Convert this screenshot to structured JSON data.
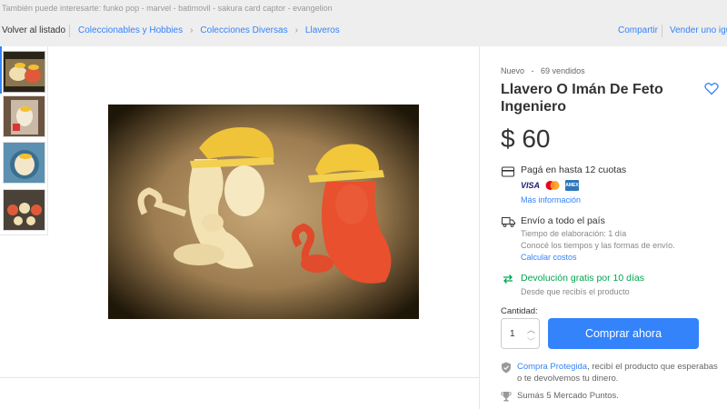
{
  "suggestions": "También puede interesarte: funko pop - marvel - batimovil - sakura card captor - evangelion",
  "nav": {
    "back": "Volver al listado",
    "breadcrumbs": [
      "Coleccionables y Hobbies",
      "Colecciones Diversas",
      "Llaveros"
    ],
    "share": "Compartir",
    "sell": "Vender uno igu"
  },
  "product": {
    "condition": "Nuevo",
    "dot": "-",
    "sold": "69 vendidos",
    "title": "Llavero O Imán De Feto Ingeniero",
    "price": "$ 60"
  },
  "payment": {
    "title": "Pagá en hasta 12 cuotas",
    "cards": [
      "VISA",
      "mastercard",
      "AMEX"
    ],
    "more": "Más información"
  },
  "shipping": {
    "title": "Envío a todo el país",
    "prep": "Tiempo de elaboración: 1 día",
    "know": "Conocé los tiempos y las formas de envío.",
    "calc": "Calcular costos"
  },
  "returns": {
    "title": "Devolución gratis por 10 días",
    "sub": "Desde que recibís el producto"
  },
  "purchase": {
    "qty_label": "Cantidad:",
    "qty_value": "1",
    "buy_label": "Comprar ahora"
  },
  "protection": {
    "link": "Compra Protegida",
    "text": ", recibí el producto que esperabas o te devolvemos tu dinero.",
    "points": "Sumás 5 Mercado Puntos."
  },
  "colors": {
    "accent": "#3483fa",
    "green": "#00a650"
  }
}
